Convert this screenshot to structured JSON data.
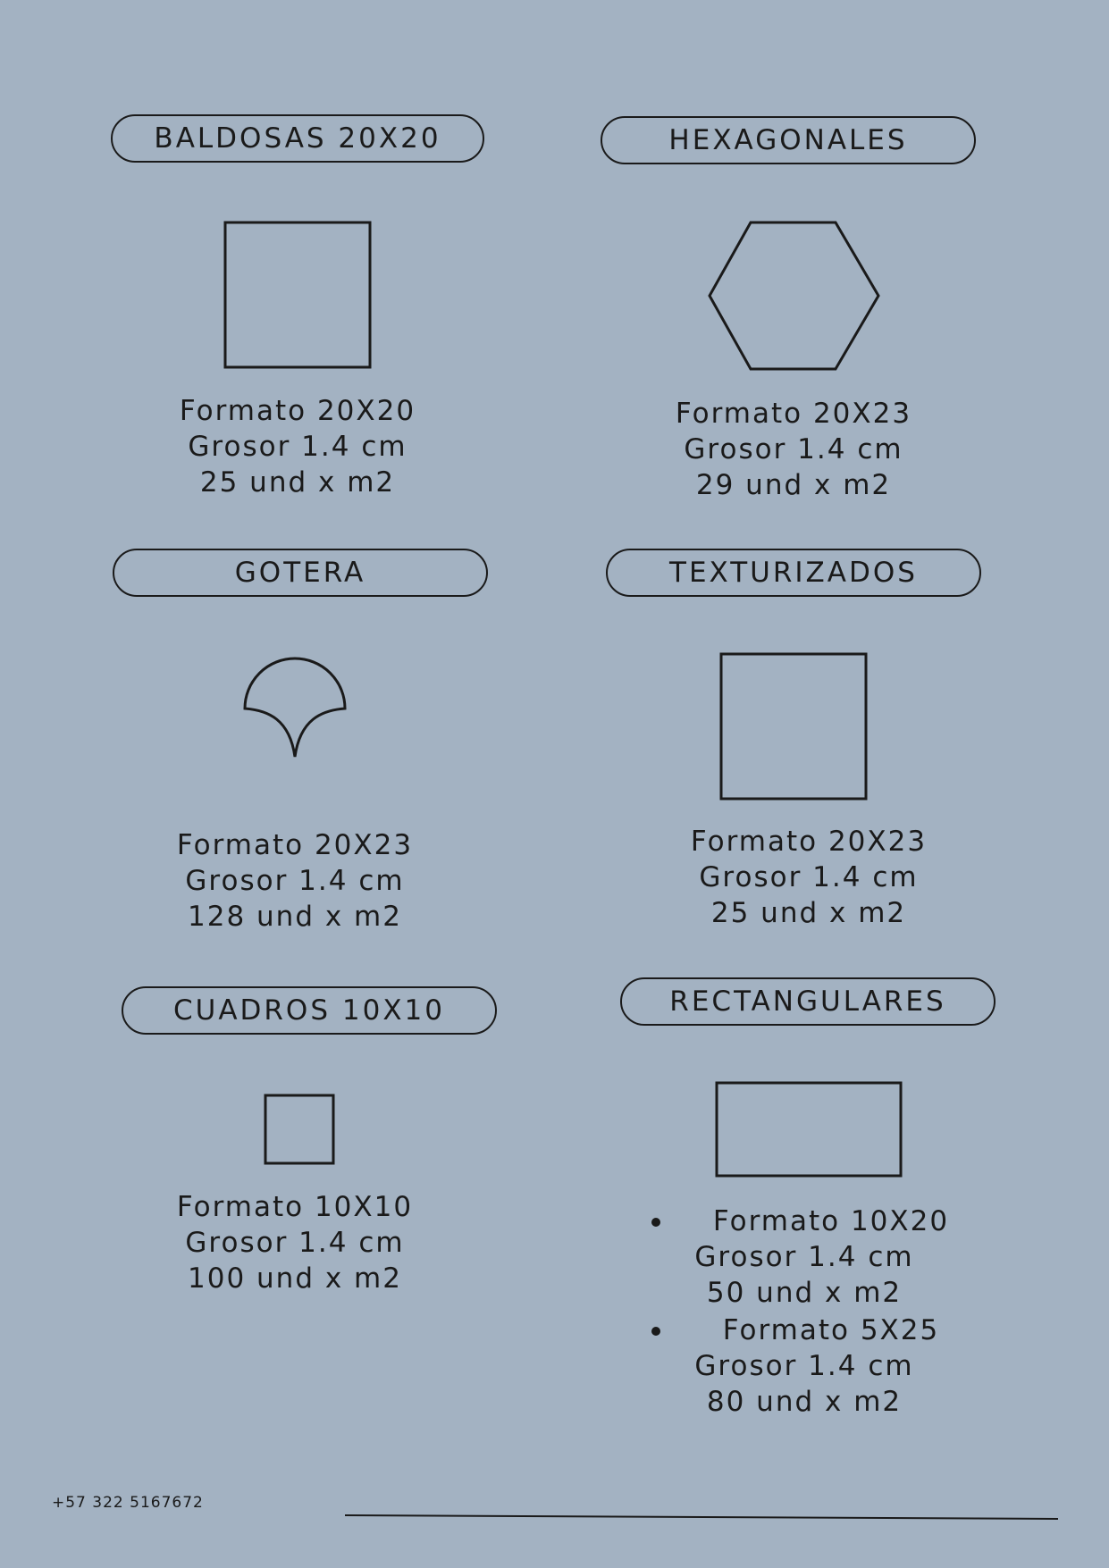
{
  "sections": [
    {
      "title": "BALDOSAS 20X20",
      "formato": "Formato 20X20",
      "grosor": "Grosor 1.4 cm",
      "unidades": "25 und x m2",
      "shape_icon": "square-icon"
    },
    {
      "title": "HEXAGONALES",
      "formato": "Formato 20X23",
      "grosor": "Grosor 1.4 cm",
      "unidades": "29 und x m2",
      "shape_icon": "hexagon-icon"
    },
    {
      "title": "GOTERA",
      "formato": "Formato 20X23",
      "grosor": "Grosor 1.4 cm",
      "unidades": "128 und x m2",
      "shape_icon": "scallop-icon"
    },
    {
      "title": "TEXTURIZADOS",
      "formato": "Formato 20X23",
      "grosor": "Grosor 1.4 cm",
      "unidades": "25 und x m2",
      "shape_icon": "square-icon"
    },
    {
      "title": "CUADROS 10X10",
      "formato": "Formato 10X10",
      "grosor": "Grosor 1.4 cm",
      "unidades": "100 und x m2",
      "shape_icon": "small-square-icon"
    },
    {
      "title": "RECTANGULARES",
      "shape_icon": "rectangle-icon",
      "variants": [
        {
          "formato": "Formato 10X20",
          "grosor": "Grosor 1.4 cm",
          "unidades": "50 und x m2"
        },
        {
          "formato": "Formato 5X25",
          "grosor": "Grosor 1.4 cm",
          "unidades": "80 und x m2"
        }
      ]
    }
  ],
  "footer": {
    "phone": "+57 322 5167672"
  },
  "colors": {
    "background": "#a3b2c2",
    "ink": "#1a1a1a"
  }
}
